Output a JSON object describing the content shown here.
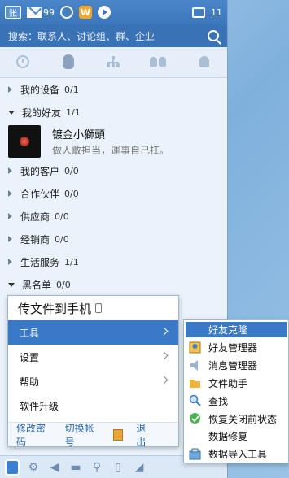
{
  "topbar": {
    "account_icon_label": "账",
    "mail_count": "99",
    "message_count": "11",
    "icons": [
      "account-icon",
      "mail-icon",
      "cloud-icon",
      "weibo-icon",
      "play-icon",
      "message-center-icon"
    ]
  },
  "search": {
    "placeholder": "搜索：联系人、讨论组、群、企业"
  },
  "tabs": [
    "recent-icon",
    "friends-icon",
    "organization-icon",
    "groups-icon",
    "contacts-icon"
  ],
  "groups": [
    {
      "name": "我的设备",
      "count": "0/1",
      "expanded": false
    },
    {
      "name": "我的好友",
      "count": "1/1",
      "expanded": true
    },
    {
      "name": "我的客户",
      "count": "0/0",
      "expanded": false
    },
    {
      "name": "合作伙伴",
      "count": "0/0",
      "expanded": false
    },
    {
      "name": "供应商",
      "count": "0/0",
      "expanded": false
    },
    {
      "name": "经销商",
      "count": "0/0",
      "expanded": false
    },
    {
      "name": "生活服务",
      "count": "1/1",
      "expanded": false
    },
    {
      "name": "黑名单",
      "count": "0/0",
      "expanded": true
    }
  ],
  "contact": {
    "name": "镀金小獅頭",
    "signature": "做人敢担当，運事自己扛。"
  },
  "main_menu": {
    "header": "传文件到手机",
    "items": [
      {
        "label": "工具",
        "has_sub": true,
        "selected": true
      },
      {
        "label": "设置",
        "has_sub": true
      },
      {
        "label": "帮助",
        "has_sub": true
      },
      {
        "label": "软件升级",
        "has_sub": false
      }
    ],
    "footer": {
      "change_password": "修改密码",
      "switch_account": "切换帐号",
      "exit": "退出"
    }
  },
  "tools_submenu": [
    {
      "label": "好友克隆",
      "selected": true
    },
    {
      "label": "好友管理器",
      "icon": "friend-manager-icon"
    },
    {
      "label": "消息管理器",
      "icon": "message-manager-icon"
    },
    {
      "label": "文件助手",
      "icon": "folder-icon"
    },
    {
      "label": "查找",
      "icon": "search-icon"
    },
    {
      "label": "恢复关闭前状态",
      "icon": "restore-icon"
    },
    {
      "label": "数据修复",
      "icon": ""
    },
    {
      "label": "数据导入工具",
      "icon": "import-icon"
    }
  ],
  "colors": {
    "accent": "#3a79c6",
    "topbar": "#3c76bb",
    "panel": "#eaf3fb"
  }
}
